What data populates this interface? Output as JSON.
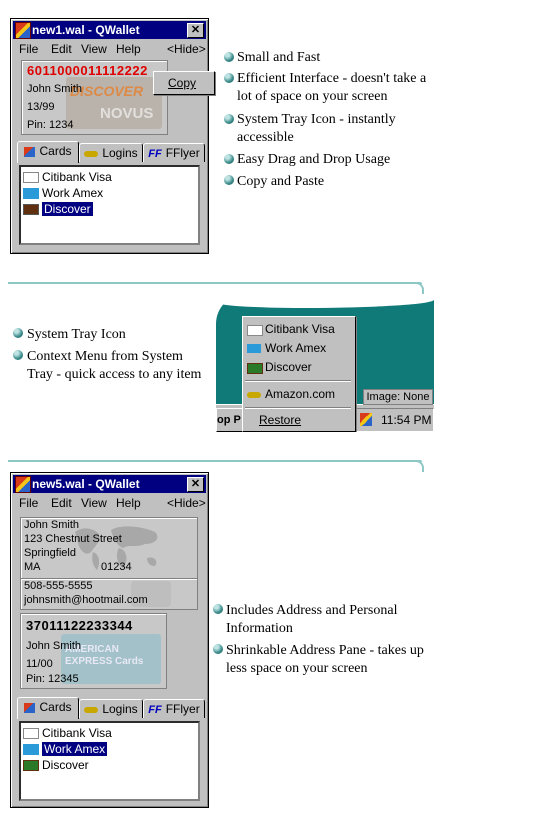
{
  "window1": {
    "title": "new1.wal - QWallet",
    "menu": [
      "File",
      "Edit",
      "View",
      "Help"
    ],
    "hide_label": "<Hide>",
    "card_number": "6011000011112222",
    "card_name": "John Smith",
    "card_expiry": "13/99",
    "card_pin": "Pin: 1234",
    "card_logo_1": "DISCOVER",
    "card_logo_2": "NOVUS",
    "copy_label": "Copy",
    "tabs": [
      "Cards",
      "Logins",
      "FFlyer"
    ],
    "items": [
      "Citibank Visa",
      "Work Amex",
      "Discover"
    ]
  },
  "features1": [
    "Small and Fast",
    "Efficient Interface - doesn't take a lot of space on your screen",
    "System Tray Icon - instantly accessible",
    "Easy Drag and Drop Usage",
    "Copy and Paste"
  ],
  "features2": [
    "System Tray Icon",
    "Context Menu from System Tray - quick access to any item"
  ],
  "tray": {
    "menu_items": [
      "Citibank Visa",
      "Work Amex",
      "Discover",
      "Amazon.com",
      "Restore"
    ],
    "image_none": "Image: None",
    "taskbar_text": "op P",
    "clock": "11:54 PM"
  },
  "window2": {
    "title": "new5.wal - QWallet",
    "menu": [
      "File",
      "Edit",
      "View",
      "Help"
    ],
    "hide_label": "<Hide>",
    "address": [
      "John Smith",
      "123 Chestnut Street",
      "Springfield",
      "MA"
    ],
    "zip": "01234",
    "phone": "508-555-5555",
    "email": "johnsmith@hootmail.com",
    "card_number": "37011122233344",
    "card_name": "John Smith",
    "card_expiry": "11/00",
    "card_pin": "Pin: 12345",
    "card_logo": "AMERICAN EXPRESS Cards",
    "tabs": [
      "Cards",
      "Logins",
      "FFlyer"
    ],
    "items": [
      "Citibank Visa",
      "Work Amex",
      "Discover"
    ]
  },
  "features3": [
    "Includes Address and Personal Information",
    "Shrinkable Address Pane - takes up less space on your screen"
  ]
}
